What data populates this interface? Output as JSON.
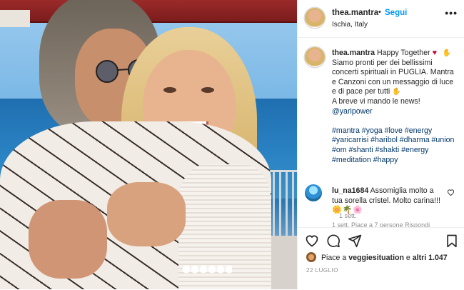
{
  "header": {
    "username": "thea.mantra",
    "dot": "•",
    "follow_label": "Segui",
    "location": "Ischia, Italy",
    "more_label": "•••"
  },
  "caption": {
    "username": "thea.mantra",
    "line1": "Happy Together",
    "line2": "Siamo pronti per dei bellissimi concerti spirituali in PUGLIA. Mantra e Canzoni con un messaggio di luce e di pace per tutti",
    "line3": "A breve vi mando le news!",
    "mention": "@yaripower",
    "hashtags": "#mantra #yoga #love #energy #yaricarrisi #haribol #dharma #union #om #shanti #shakti #energy #meditation #happy",
    "time": "1 sett."
  },
  "comment": {
    "username": "lu_na1684",
    "text": "Assomiglia molto a tua sorella cristel. Molto carina!!!",
    "emojis": "🌼🌴🌸",
    "meta": "1 sett.     Piace a 7 persone     Rispondi"
  },
  "actions": {
    "likes_prefix": "Piace a",
    "likes_user": "veggiesituation",
    "likes_mid": "e",
    "likes_others": "altri 1.047",
    "date": "22 LUGLIO"
  },
  "icons": {
    "like": "heart-icon",
    "comment": "comment-icon",
    "share": "share-icon",
    "save": "bookmark-icon",
    "more": "more-icon"
  }
}
